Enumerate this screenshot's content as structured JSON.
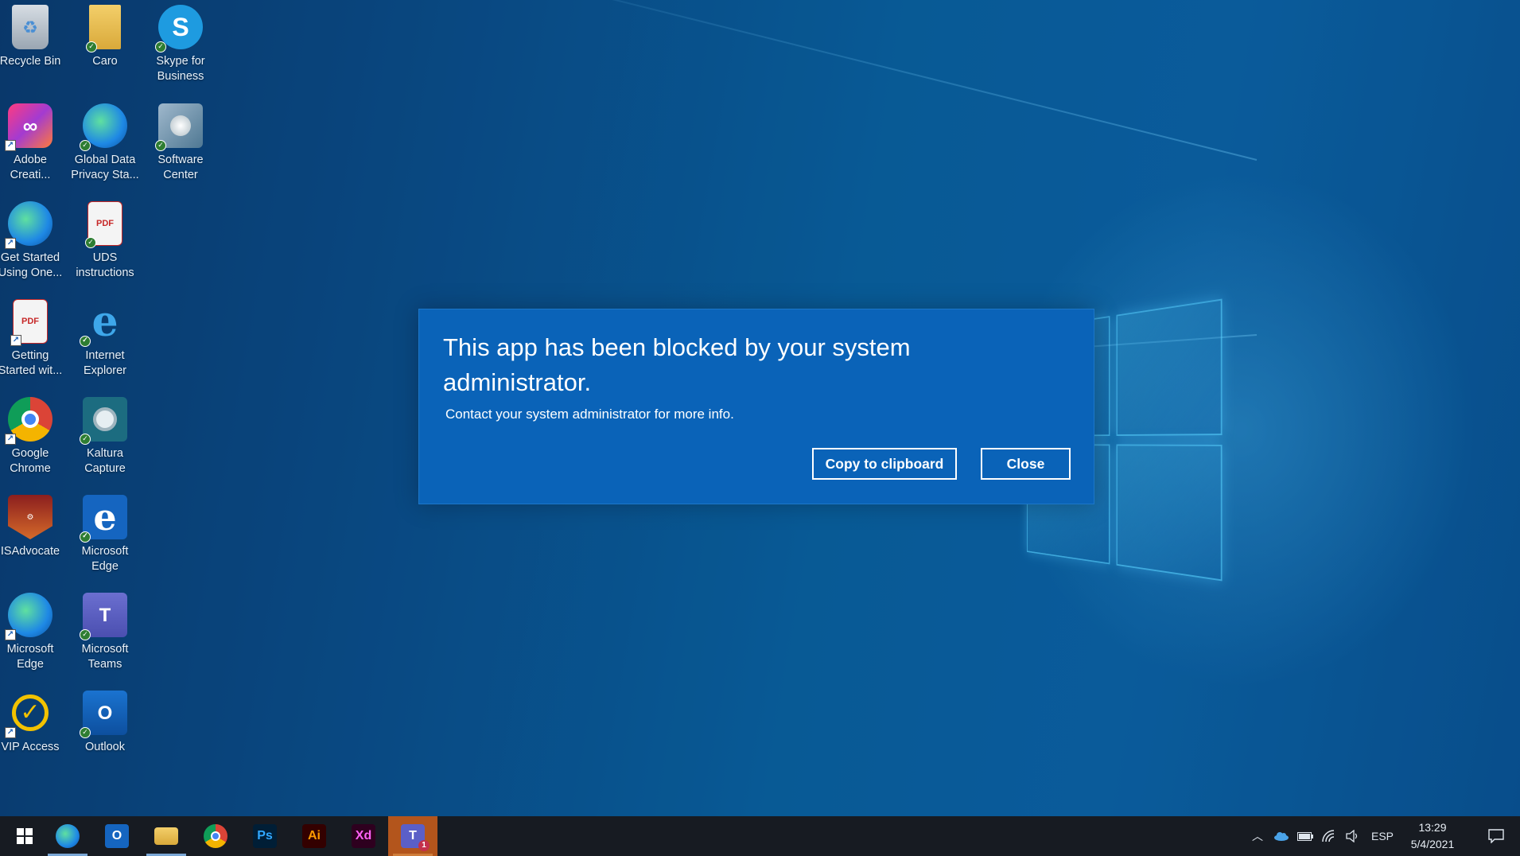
{
  "desktop_icons": [
    {
      "label": "Recycle Bin",
      "icon": "recycle-bin-icon"
    },
    {
      "label": "Caro",
      "icon": "folder-icon"
    },
    {
      "label": "Skype for Business",
      "icon": "skype-icon"
    },
    {
      "label": "Adobe Creati...",
      "icon": "adobe-creative-cloud-icon"
    },
    {
      "label": "Global Data Privacy Sta...",
      "icon": "edge-icon"
    },
    {
      "label": "Software Center",
      "icon": "software-center-icon"
    },
    {
      "label": "Get Started Using One...",
      "icon": "edge-icon"
    },
    {
      "label": "UDS instructions",
      "icon": "pdf-icon"
    },
    {
      "label": "Getting Started wit...",
      "icon": "pdf-icon"
    },
    {
      "label": "Internet Explorer",
      "icon": "internet-explorer-icon"
    },
    {
      "label": "Google Chrome",
      "icon": "chrome-icon"
    },
    {
      "label": "Kaltura Capture",
      "icon": "kaltura-icon"
    },
    {
      "label": "ISAdvocate",
      "icon": "isadvocate-icon"
    },
    {
      "label": "Microsoft Edge",
      "icon": "edge-legacy-icon"
    },
    {
      "label": "Microsoft Edge",
      "icon": "edge-icon"
    },
    {
      "label": "Microsoft Teams",
      "icon": "teams-icon"
    },
    {
      "label": "VIP Access",
      "icon": "vip-access-icon"
    },
    {
      "label": "Outlook",
      "icon": "outlook-icon"
    }
  ],
  "dialog": {
    "title": "This app has been blocked by your system administrator.",
    "message": "Contact your system administrator for more info.",
    "copy_button": "Copy to clipboard",
    "close_button": "Close"
  },
  "taskbar": {
    "pdf_glyph": "PDF",
    "teams_badge": "1",
    "apps": [
      {
        "name": "start-button",
        "glyph": ""
      },
      {
        "name": "edge",
        "glyph": ""
      },
      {
        "name": "outlook",
        "glyph": "O"
      },
      {
        "name": "file-explorer",
        "glyph": ""
      },
      {
        "name": "chrome",
        "glyph": ""
      },
      {
        "name": "photoshop",
        "glyph": "Ps"
      },
      {
        "name": "illustrator",
        "glyph": "Ai"
      },
      {
        "name": "xd",
        "glyph": "Xd"
      },
      {
        "name": "teams",
        "glyph": "T"
      }
    ],
    "language": "ESP",
    "time": "13:29",
    "date": "5/4/2021"
  },
  "colors": {
    "dialog_bg": "#0a63b8",
    "taskbar_bg": "#171b22",
    "ps": "#31a8ff",
    "ai": "#ff9a00",
    "xd": "#ff61f6"
  }
}
